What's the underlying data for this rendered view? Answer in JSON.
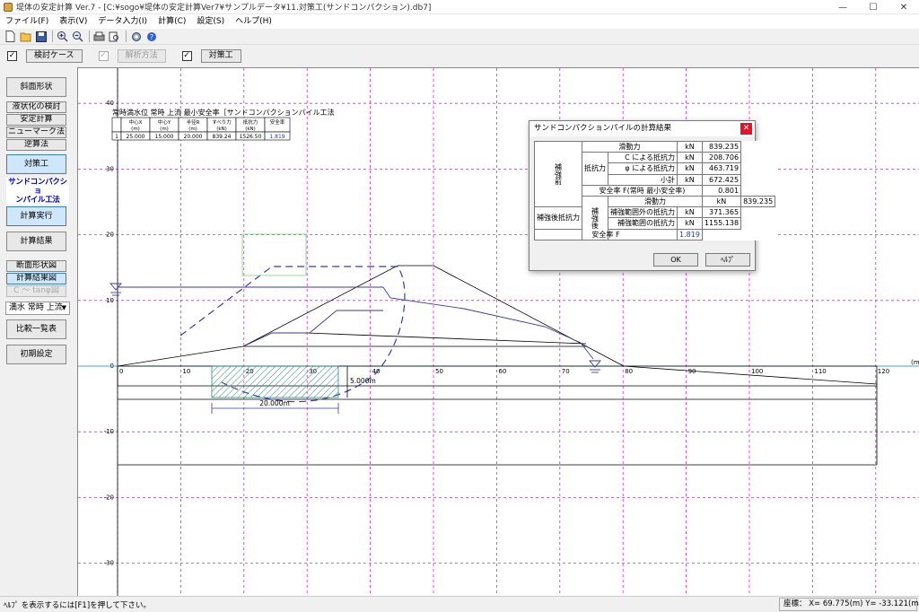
{
  "window": {
    "title": "堤体の安定計算 Ver.7 - [C:¥sogo¥堤体の安定計算Ver7¥サンプルデータ¥11.対策工(サンドコンパクション).db7]",
    "minimize": "—",
    "maximize": "☐",
    "close": "✕"
  },
  "menu": [
    "ファイル(F)",
    "表示(V)",
    "データ入力(I)",
    "計算(C)",
    "設定(S)",
    "ヘルプ(H)"
  ],
  "toolbar_icons": [
    "new-file-icon",
    "open-folder-icon",
    "save-icon",
    "zoom-in-icon",
    "zoom-out-icon",
    "print-icon",
    "print-preview-icon",
    "settings-icon",
    "help-icon"
  ],
  "commands": {
    "case_check": "✓",
    "case_label": "検討ケース",
    "method_check": "✓",
    "method_label": "解析方法",
    "measure_check": "✓",
    "measure_label": "対策工"
  },
  "sidebar": {
    "slope_shape": "斜面形状",
    "liquefaction": "液状化の検討",
    "stability": "安定計算",
    "newmark": "ニューマーク法",
    "inverse": "逆算法",
    "countermeasure": "対策工",
    "scp_line1": "サンドコンパクショ",
    "scp_line2": "ンパイル工法",
    "run_calc": "計算実行",
    "calc_result": "計算結果",
    "section_fig": "断面形状図",
    "result_fig": "計算結果図",
    "c_tan_fig": "C ～ tanφ図",
    "case_select": "満水 常時 上流",
    "compare": "比較一覧表",
    "init": "初期設定"
  },
  "plot": {
    "y_ticks": [
      "40",
      "30",
      "20",
      "10",
      "0",
      "-10",
      "-20",
      "-30"
    ],
    "x_ticks": [
      "0",
      "10",
      "20",
      "30",
      "40",
      "50",
      "60",
      "70",
      "80",
      "90",
      "100",
      "110",
      "120"
    ],
    "x_unit": "(m)",
    "dim_width": "20.000m",
    "dim_depth": "5.000m"
  },
  "summary": {
    "title": "常時満水位 常時 上流 最小安全率［サンドコンパクションパイル工法",
    "headers": [
      "",
      "中心X\n(m)",
      "中心Y\n(m)",
      "半径R\n(m)",
      "すべり力\n(kN)",
      "抵抗力\n(kN)",
      "安全率"
    ],
    "row": [
      "1",
      "25.000",
      "15.000",
      "20.000",
      "839.24",
      "1526.50",
      "1.819"
    ]
  },
  "dialog": {
    "title": "サンドコンパクションパイルの計算結果",
    "close": "✕",
    "before": "補強前",
    "after": "補強後",
    "sliding": "滑動力",
    "resist": "抵抗力",
    "c_resist": "C による抵抗力",
    "phi_resist": "φ による抵抗力",
    "subtotal": "小計",
    "fs_before": "安全率 F(常時 最小安全率)",
    "sliding2": "滑動力",
    "resist_after": "補強後抵抗力",
    "out_resist": "補強範囲外の抵抗力",
    "in_resist": "補強範囲の抵抗力",
    "fs_after": "安全率 F",
    "unit": "kN",
    "vals": {
      "sliding": "839.235",
      "c": "208.706",
      "phi": "463.719",
      "subtotal": "672.425",
      "fs_before": "0.801",
      "sliding2": "839.235",
      "out": "371.365",
      "in": "1155.138",
      "fs_after": "1.819"
    },
    "ok": "OK",
    "help": "ﾍﾙﾌﾟ"
  },
  "status": {
    "hint": "ﾍﾙﾌﾟ を表示するには[F1]を押して下さい。",
    "coords": "座標： X=  69.775(m) Y= -33.121(m)"
  },
  "colors": {
    "grid": "#cc33cc",
    "blue": "#3a3aa8",
    "hatch": "#2a8a7a"
  }
}
